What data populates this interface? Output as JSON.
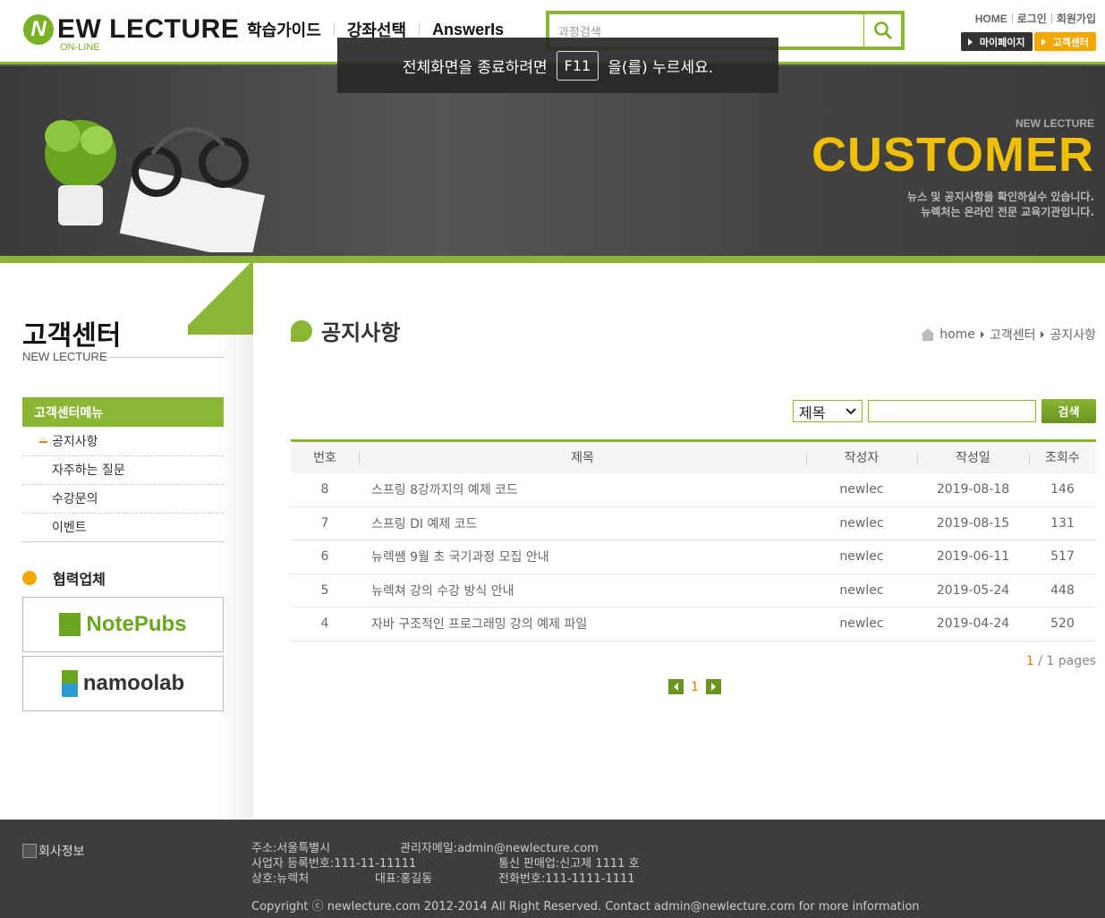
{
  "header": {
    "logo_text": "EW LECTURE",
    "logo_letter": "N",
    "logo_sub": "ON-LINE",
    "nav": [
      "학습가이드",
      "강좌선택",
      "AnswerIs"
    ],
    "search_placeholder": "과정검색",
    "top_links": [
      "HOME",
      "로그인",
      "회원가입"
    ],
    "mypage_label": "마이페이지",
    "customer_label": "고객센터"
  },
  "fullscreen_notice": {
    "before": "전체화면을 종료하려면",
    "key": "F11",
    "after": "을(를) 누르세요."
  },
  "banner": {
    "small": "NEW LECTURE",
    "big": "CUSTOMER",
    "desc1": "뉴스 및 공지사항을 확인하실수 있습니다.",
    "desc2": "뉴렉처는 온라인 전문 교육기관입니다."
  },
  "aside": {
    "title": "고객센터",
    "eng": "NEW LECTURE",
    "menu_head": "고객센터메뉴",
    "menu": [
      "공지사항",
      "자주하는 질문",
      "수강문의",
      "이벤트"
    ],
    "partner_head": "협력업체",
    "partners": [
      "NotePubs",
      "namoolab"
    ]
  },
  "main": {
    "title": "공지사항",
    "breadcrumb": [
      "home",
      "고객센터",
      "공지사항"
    ],
    "filter_option": "제목",
    "search_button": "검색",
    "columns": [
      "번호",
      "제목",
      "작성자",
      "작성일",
      "조회수"
    ],
    "rows": [
      {
        "no": "8",
        "title": "스프링 8강까지의 예제 코드",
        "writer": "newlec",
        "date": "2019-08-18",
        "hit": "146"
      },
      {
        "no": "7",
        "title": "스프링 DI 예제 코드",
        "writer": "newlec",
        "date": "2019-08-15",
        "hit": "131"
      },
      {
        "no": "6",
        "title": "뉴렉쌤 9월 초 국기과정 모집 안내",
        "writer": "newlec",
        "date": "2019-06-11",
        "hit": "517"
      },
      {
        "no": "5",
        "title": "뉴렉쳐 강의 수강 방식 안내",
        "writer": "newlec",
        "date": "2019-05-24",
        "hit": "448"
      },
      {
        "no": "4",
        "title": "자바 구조적인 프로그래밍 강의 예제 파일",
        "writer": "newlec",
        "date": "2019-04-24",
        "hit": "520"
      }
    ],
    "page_current": "1",
    "page_total": "/ 1 pages",
    "pager_num": "1"
  },
  "footer": {
    "logo_alt": "회사정보",
    "address": "주소:서울특별시",
    "admin_email": "관리자메일:admin@newlecture.com",
    "biz_no": "사업자 등록번호:111-11-11111",
    "sale_no": "통신 판매업:신고제 1111 호",
    "company": "상호:뉴렉처",
    "ceo": "대표:홍길동",
    "phone": "전화번호:111-1111-1111",
    "copyright": "Copyright ⓒ newlecture.com 2012-2014 All Right Reserved. Contact admin@newlecture.com for more information"
  },
  "colors": {
    "accent": "#8bb534",
    "orange": "#f3a800",
    "footer": "#3d3d3d"
  }
}
